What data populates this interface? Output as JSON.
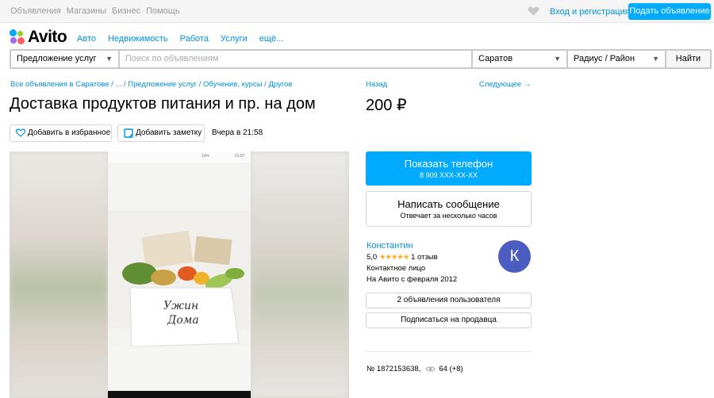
{
  "topbar": {
    "nav": [
      "Объявления",
      "Магазины",
      "Бизнес",
      "Помощь"
    ],
    "login": "Вход и регистрация",
    "post_ad": "Подать объявление"
  },
  "logo": {
    "text": "Avito"
  },
  "categories": [
    "Авто",
    "Недвижимость",
    "Работа",
    "Услуги",
    "ещё..."
  ],
  "search": {
    "category": "Предложение услуг",
    "placeholder": "Поиск по объявлениям",
    "city": "Саратов",
    "radius": "Радиус / Район",
    "find": "Найти"
  },
  "breadcrumbs": "Все объявления в Саратове / ... / Предложение услуг / Обучение, курсы / Другое",
  "nav": {
    "back": "Назад",
    "next": "Следующее →"
  },
  "ad": {
    "title": "Доставка продуктов питания и пр. на дом",
    "price": "200 ₽",
    "add_favorite": "Добавить в избранное",
    "add_note": "Добавить заметку",
    "date": "Вчера в 21:58",
    "number": "№ 1872153638,",
    "views": "64 (+8)"
  },
  "contact": {
    "show_phone": "Показать телефон",
    "phone_masked": "8 909 XXX-XX-XX",
    "write_message": "Написать сообщение",
    "reply_time": "Отвечает за несколько часов"
  },
  "seller": {
    "name": "Константин",
    "rating": "5,0",
    "stars": "★★★★★",
    "reviews": "1 отзыв",
    "type": "Контактное лицо",
    "since": "На Авито с февраля 2012",
    "avatar_letter": "К",
    "user_ads": "2 объявления пользователя",
    "subscribe": "Подписаться на продавца"
  },
  "photo": {
    "status_time": "21:57",
    "status_battery": "14%",
    "box_text_1": "Ужин",
    "box_text_2": "Дома"
  },
  "colors": {
    "accent": "#00aaff",
    "link": "#0091d9",
    "avatar": "#4b5dc0",
    "stars": "#ffb021"
  },
  "icons": [
    "heart-icon",
    "avito-logo-icon",
    "chevron-down-icon",
    "note-icon",
    "eye-icon"
  ]
}
